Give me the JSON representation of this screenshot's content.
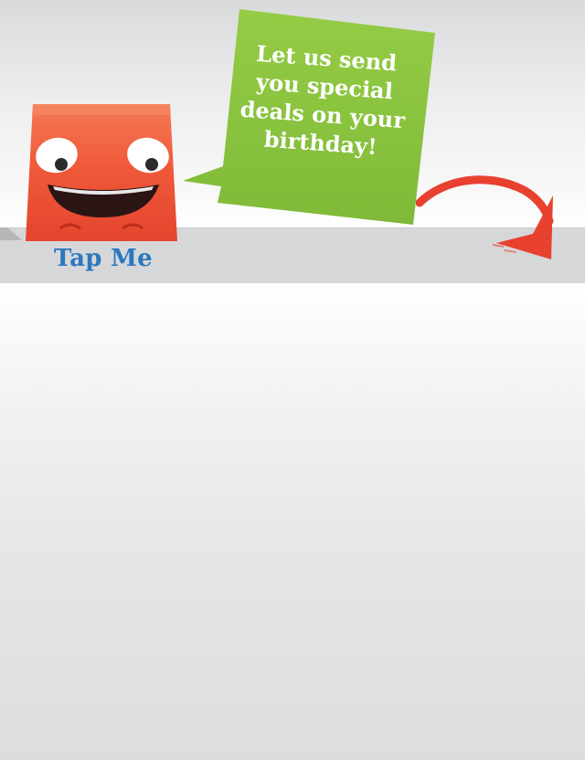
{
  "promo": {
    "bubble_text": "Let us send\nyou special\ndeals on your\nbirthday!",
    "tap_label": "Tap Me"
  },
  "mascot": {
    "icon": "red-monster-mascot-icon",
    "body_color": "#f05a3b",
    "mouth_color": "#2a1414"
  },
  "colors": {
    "bubble": "#8dc63f",
    "tap_label": "#2c78bf",
    "arrow": "#e8412f"
  },
  "icons": {
    "arrow": "curved-arrow-icon"
  }
}
